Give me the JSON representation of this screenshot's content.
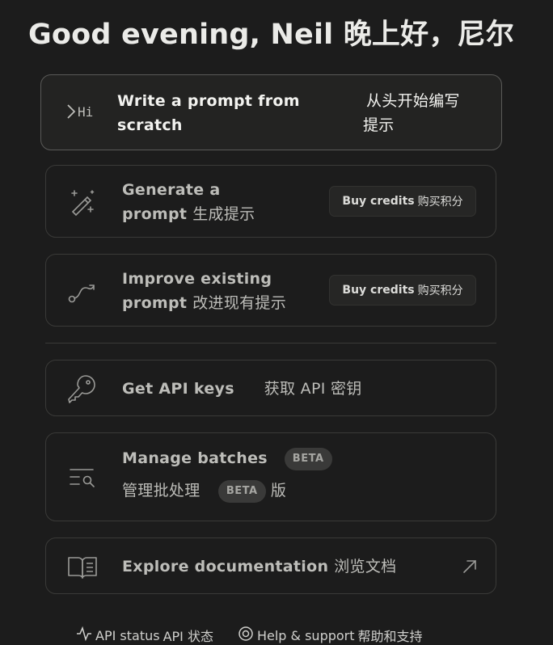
{
  "greeting": "Good evening, Neil 晚上好，尼尔",
  "cards": {
    "write": {
      "icon": "terminal-hi-icon",
      "title_line1": "Write a prompt from",
      "title_line2": "scratch",
      "cjk_line1": "从头开始编写",
      "cjk_line2": "提示"
    },
    "generate": {
      "icon": "magic-wand-icon",
      "title_line1": "Generate a",
      "title_line2": "prompt",
      "cjk": "生成提示",
      "button_en": "Buy credits",
      "button_cjk": "购买积分"
    },
    "improve": {
      "icon": "curve-path-icon",
      "title_line1": "Improve existing",
      "title_line2": "prompt",
      "cjk": "改进现有提示",
      "button_en": "Buy credits",
      "button_cjk": "购买积分"
    },
    "api": {
      "icon": "key-icon",
      "title": "Get API keys",
      "cjk": "获取 API 密钥"
    },
    "batches": {
      "icon": "list-search-icon",
      "title": "Manage batches",
      "badge": "BETA",
      "cjk": "管理批处理",
      "badge2": "BETA",
      "cjk_suffix": "版"
    },
    "docs": {
      "icon": "book-icon",
      "title": "Explore documentation",
      "cjk": "浏览文档",
      "arrow": "arrow-up-right-icon"
    }
  },
  "footer": {
    "status": "API status",
    "status_cjk": "API 状态",
    "help": "Help & support",
    "help_cjk": "帮助和支持"
  }
}
